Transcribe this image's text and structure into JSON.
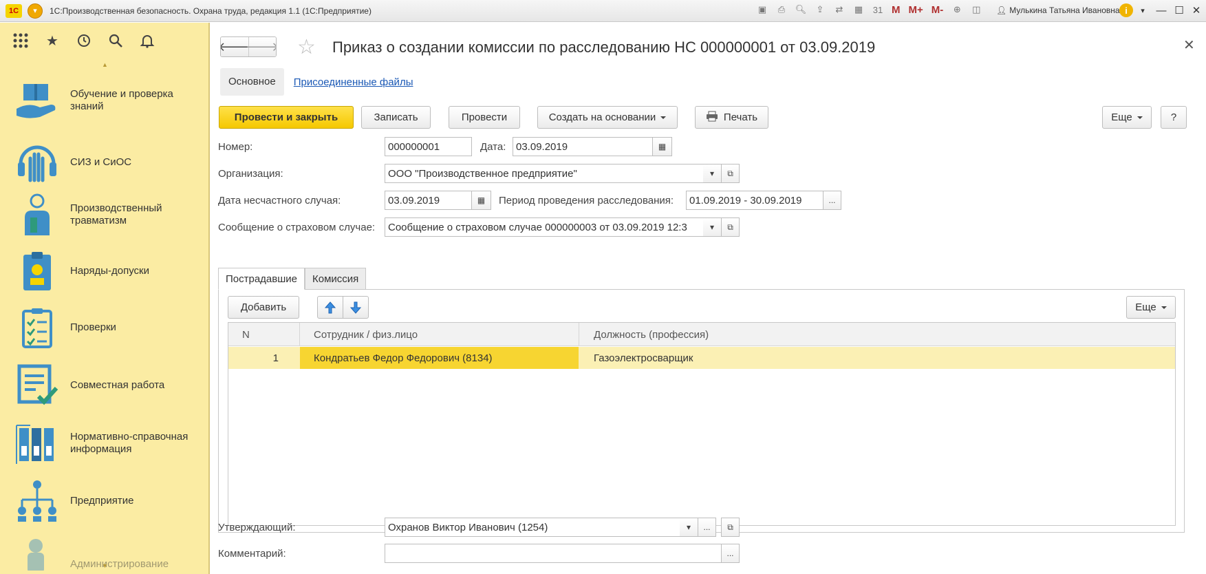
{
  "window": {
    "logo_text": "1С",
    "title": "1С:Производственная безопасность. Охрана труда, редакция 1.1  (1С:Предприятие)",
    "user": "Мулькина Татьяна Ивановна",
    "m_label": "M",
    "mplus_label": "M+",
    "mminus_label": "M-"
  },
  "sidebar": {
    "items": [
      {
        "label": "Обучение и проверка знаний",
        "icon": "education-hand-book-icon"
      },
      {
        "label": "СИЗ и СиОС",
        "icon": "helmet-glove-icon"
      },
      {
        "label": "Производственный травматизм",
        "icon": "injured-worker-icon"
      },
      {
        "label": "Наряды-допуски",
        "icon": "permit-badge-icon"
      },
      {
        "label": "Проверки",
        "icon": "checklist-clipboard-icon"
      },
      {
        "label": "Совместная работа",
        "icon": "document-check-icon"
      },
      {
        "label": "Нормативно-справочная информация",
        "icon": "binders-icon"
      },
      {
        "label": "Предприятие",
        "icon": "org-structure-icon"
      },
      {
        "label": "Администрирование",
        "icon": "admin-icon"
      }
    ]
  },
  "document": {
    "title": "Приказ о создании комиссии по расследованию НС 000000001 от 03.09.2019",
    "tab_main": "Основное",
    "tab_files": "Присоединенные файлы"
  },
  "toolbar": {
    "post_close": "Провести и закрыть",
    "save": "Записать",
    "post": "Провести",
    "create_based": "Создать на основании",
    "print": "Печать",
    "more": "Еще",
    "help": "?"
  },
  "form": {
    "number_label": "Номер:",
    "number_value": "000000001",
    "date_label": "Дата:",
    "date_value": "03.09.2019",
    "org_label": "Организация:",
    "org_value": "ООО \"Производственное предприятие\"",
    "accident_date_label": "Дата несчастного случая:",
    "accident_date_value": "03.09.2019",
    "period_label": "Период проведения расследования:",
    "period_value": "01.09.2019 - 30.09.2019",
    "message_label": "Сообщение о страховом случае:",
    "message_value": "Сообщение о страховом случае 000000003 от 03.09.2019 12:3",
    "approver_label": "Утверждающий:",
    "approver_value": "Охранов Виктор Иванович (1254)",
    "comment_label": "Комментарий:",
    "comment_value": ""
  },
  "inner_tabs": [
    "Пострадавшие",
    "Комиссия"
  ],
  "table_toolbar": {
    "add": "Добавить",
    "more": "Еще"
  },
  "table": {
    "columns": [
      "N",
      "Сотрудник / физ.лицо",
      "Должность (профессия)"
    ],
    "rows": [
      {
        "n": "1",
        "employee": "Кондратьев Федор Федорович (8134)",
        "position": "Газоэлектросварщик"
      }
    ]
  }
}
